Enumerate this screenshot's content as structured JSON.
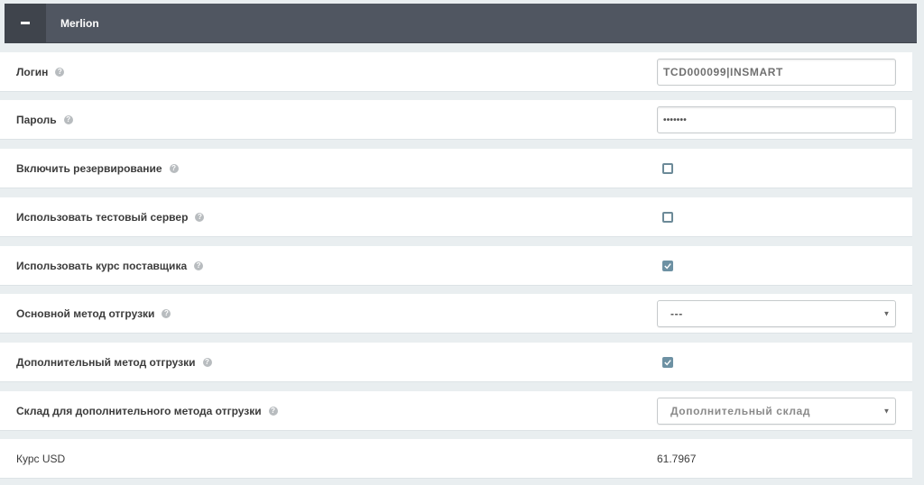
{
  "header": {
    "title": "Merlion"
  },
  "rows": {
    "login": {
      "label": "Логин",
      "value": "TCD000099|INSMART"
    },
    "password": {
      "label": "Пароль",
      "value": "•••••••"
    },
    "reserve": {
      "label": "Включить резервирование",
      "checked": false
    },
    "test_server": {
      "label": "Использовать тестовый сервер",
      "checked": false
    },
    "supplier_rate": {
      "label": "Использовать курс поставщика",
      "checked": true
    },
    "main_shipping": {
      "label": "Основной метод отгрузки",
      "selected": "---"
    },
    "extra_shipping": {
      "label": "Дополнительный метод отгрузки",
      "checked": true
    },
    "extra_warehouse": {
      "label": "Склад для дополнительного метода отгрузки",
      "selected": "Дополнительный склад"
    },
    "usd_rate": {
      "label": "Курс USD",
      "value": "61.7967"
    }
  },
  "help_glyph": "?",
  "colors": {
    "header_bg": "#505661",
    "checkbox_accent": "#6d91a3"
  }
}
